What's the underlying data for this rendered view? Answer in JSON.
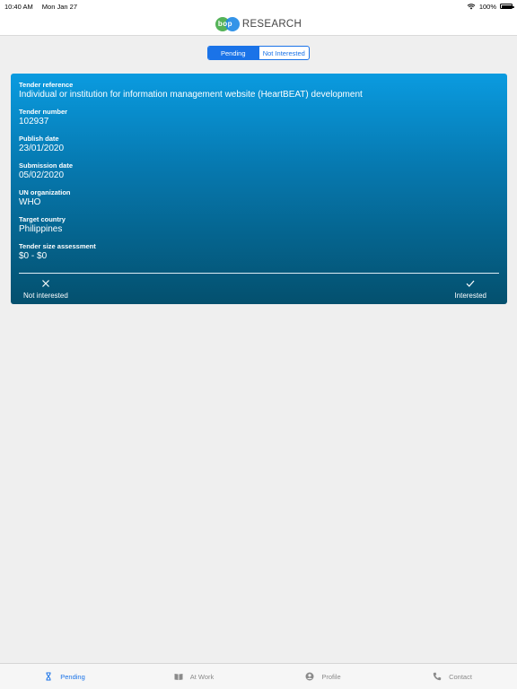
{
  "status_bar": {
    "time": "10:40 AM",
    "date": "Mon Jan 27",
    "battery": "100%"
  },
  "header": {
    "logo_mark": "bop",
    "logo_text": "RESEARCH"
  },
  "segmented": {
    "pending": "Pending",
    "not_interested": "Not Interested"
  },
  "card": {
    "fields": [
      {
        "label": "Tender reference",
        "value": "Individual or institution for information management website (HeartBEAT) development"
      },
      {
        "label": "Tender number",
        "value": "102937"
      },
      {
        "label": "Publish date",
        "value": "23/01/2020"
      },
      {
        "label": "Submission date",
        "value": "05/02/2020"
      },
      {
        "label": "UN organization",
        "value": "WHO"
      },
      {
        "label": "Target country",
        "value": "Philippines"
      },
      {
        "label": "Tender size assessment",
        "value": "$0 - $0"
      }
    ],
    "not_interested_label": "Not interested",
    "interested_label": "Interested"
  },
  "tabs": [
    {
      "label": "Pending",
      "icon": "hourglass-icon"
    },
    {
      "label": "At Work",
      "icon": "book-icon"
    },
    {
      "label": "Profile",
      "icon": "person-icon"
    },
    {
      "label": "Contact",
      "icon": "phone-icon"
    }
  ],
  "colors": {
    "accent": "#1a73e8",
    "card_top": "#0a9be0",
    "card_bottom": "#04506e"
  }
}
